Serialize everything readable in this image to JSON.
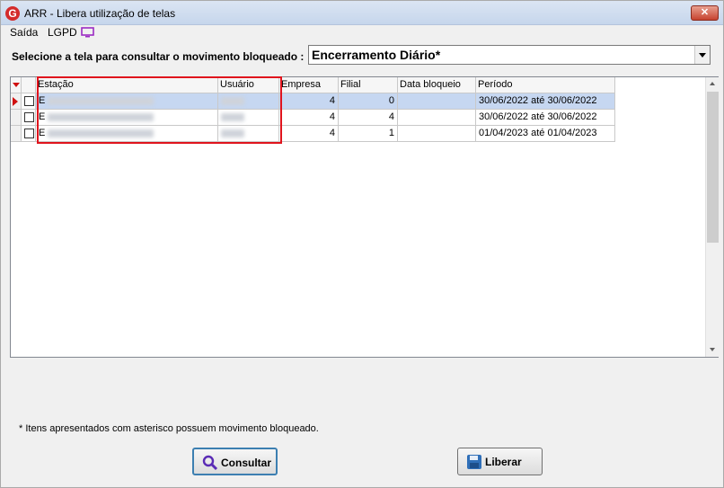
{
  "window": {
    "title": "ARR - Libera utilização de telas",
    "close_label": "✕"
  },
  "menu": {
    "items": [
      "Saída",
      "LGPD"
    ]
  },
  "selector": {
    "label": "Selecione a tela para consultar o movimento bloqueado :",
    "selected": "Encerramento Diário*"
  },
  "grid": {
    "columns": [
      "Estação",
      "Usuário",
      "Empresa",
      "Filial",
      "Data bloqueio",
      "Período"
    ],
    "rows": [
      {
        "estacao_visible": "E",
        "empresa": "4",
        "filial": "0",
        "data_bloqueio": "",
        "periodo": "30/06/2022 até 30/06/2022",
        "selected": true
      },
      {
        "estacao_visible": "E",
        "empresa": "4",
        "filial": "4",
        "data_bloqueio": "",
        "periodo": "30/06/2022 até 30/06/2022",
        "selected": false
      },
      {
        "estacao_visible": "E",
        "empresa": "4",
        "filial": "1",
        "data_bloqueio": "",
        "periodo": "01/04/2023 até 01/04/2023",
        "selected": false
      }
    ]
  },
  "footnote": "* Itens apresentados com asterisco possuem movimento bloqueado.",
  "buttons": {
    "consultar": "Consultar",
    "liberar": "Liberar"
  },
  "colors": {
    "highlight": "#e0141d",
    "selected_row": "#c6d7f1"
  }
}
